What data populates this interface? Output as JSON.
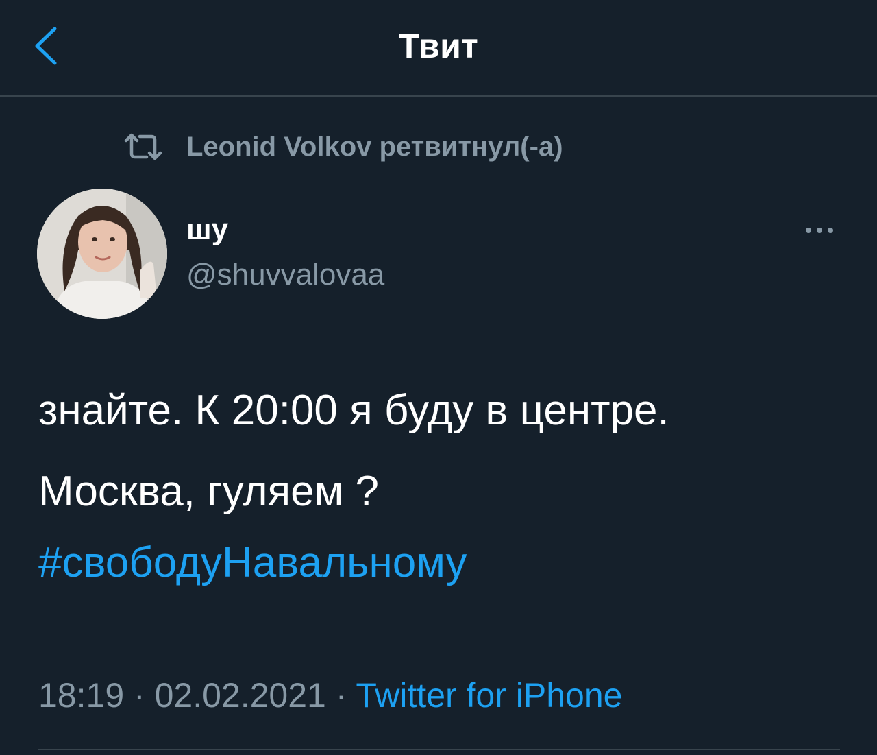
{
  "header": {
    "title": "Твит",
    "back_icon": "chevron-left-icon"
  },
  "retweet": {
    "icon": "retweet-icon",
    "text": "Leonid Volkov ретвитнул(-а)"
  },
  "author": {
    "display_name": "шу",
    "handle": "@shuvvalovaa"
  },
  "tweet": {
    "line1": "знайте. К 20:00 я буду в центре.",
    "line2": "Москва, гуляем ?",
    "hashtag": "#свободуНавальному"
  },
  "meta": {
    "time": "18:19",
    "separator": "·",
    "date": "02.02.2021",
    "source": "Twitter for iPhone"
  },
  "colors": {
    "background": "#15202b",
    "accent": "#1da1f2",
    "secondary_text": "#8899a6",
    "divider": "#38444d"
  }
}
